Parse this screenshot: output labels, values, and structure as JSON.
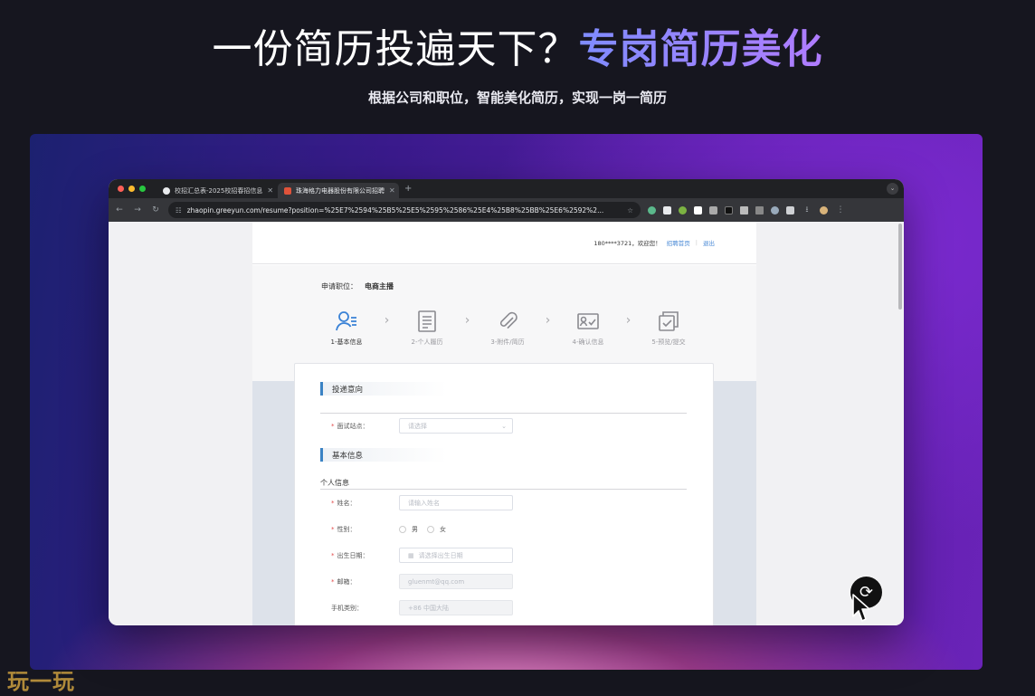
{
  "hero": {
    "title_plain": "一份简历投遍天下？",
    "title_accent": "专岗简历美化",
    "subtitle": "根据公司和职位，智能美化简历，实现一岗一简历"
  },
  "browser": {
    "tabs": [
      {
        "label": "校招汇总表-2025校招春招信息",
        "active": false
      },
      {
        "label": "珠海格力电器股份有限公司招聘",
        "active": true
      }
    ],
    "new_tab": "+",
    "url": "zhaopin.greeyun.com/resume?position=%25E7%2594%25B5%25E5%2595%2586%25E4%25B8%25BB%25E6%2592%2..."
  },
  "site": {
    "user": "180****3721，欢迎您！",
    "home_link": "招聘首页",
    "logout": "退出",
    "apply_label": "申请职位：",
    "apply_position": "电商主播",
    "steps": [
      {
        "label": "1-基本信息",
        "icon": "user-info-icon",
        "active": true
      },
      {
        "label": "2-个人履历",
        "icon": "document-icon",
        "active": false
      },
      {
        "label": "3-附件/简历",
        "icon": "attachment-icon",
        "active": false
      },
      {
        "label": "4-确认信息",
        "icon": "confirm-card-icon",
        "active": false
      },
      {
        "label": "5-预览/提交",
        "icon": "preview-submit-icon",
        "active": false
      }
    ]
  },
  "form": {
    "section_intent": "投递意向",
    "interview_site_label": "面试站点：",
    "interview_site_placeholder": "请选择",
    "section_basic": "基本信息",
    "personal_info": "个人信息",
    "name_label": "姓名：",
    "name_placeholder": "请输入姓名",
    "gender_label": "性别：",
    "gender_male": "男",
    "gender_female": "女",
    "birth_label": "出生日期：",
    "birth_placeholder": "请选择出生日期",
    "email_label": "邮箱：",
    "email_value": "gluenmt@qq.com",
    "phone_type_label": "手机类别：",
    "phone_type_value": "+86 中国大陆"
  },
  "watermark": "玩一玩",
  "colors": {
    "accent_gradient_start": "#7f8cff",
    "accent_gradient_end": "#b07cff",
    "link": "#4a8ad6",
    "section_bar": "#3a82c4"
  }
}
